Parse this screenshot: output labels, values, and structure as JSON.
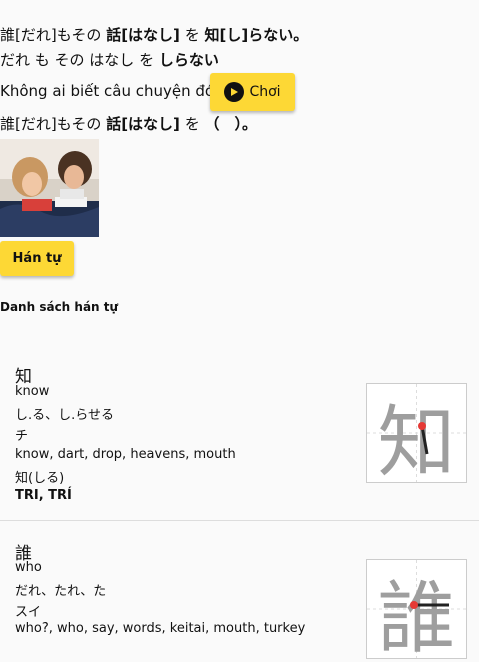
{
  "sentence": {
    "furigana_prefix": "誰[だれ]もその",
    "furigana_word": "話[はなし]",
    "furigana_particle": "を",
    "furigana_answer": "知[し]らない。",
    "kana_prefix": "だれ も その はなし を",
    "kana_answer": "しらない",
    "translation": "Không ai biết câu chuyện đó.",
    "play_label": "Chơi",
    "quiz_prefix": "誰[だれ]もその",
    "quiz_word": "話[はなし]",
    "quiz_particle": "を",
    "quiz_blank": "（　）。"
  },
  "kanji_button": "Hán tự",
  "kanji_section_title": "Danh sách hán tự",
  "kanji_list": [
    {
      "char": "知",
      "meaning": "know",
      "kun": "し.る、し.らせる",
      "on": "チ",
      "keywords": "know, dart, drop, heavens, mouth",
      "example": "知(しる)",
      "hanviet": "TRI, TRÍ"
    },
    {
      "char": "誰",
      "meaning": "who",
      "kun": "だれ、たれ、た",
      "on": "スイ",
      "keywords": "who?, who, say, words, keitai, mouth, turkey"
    }
  ],
  "colors": {
    "accent": "#fdd835",
    "stroke_dot": "#e53935"
  }
}
